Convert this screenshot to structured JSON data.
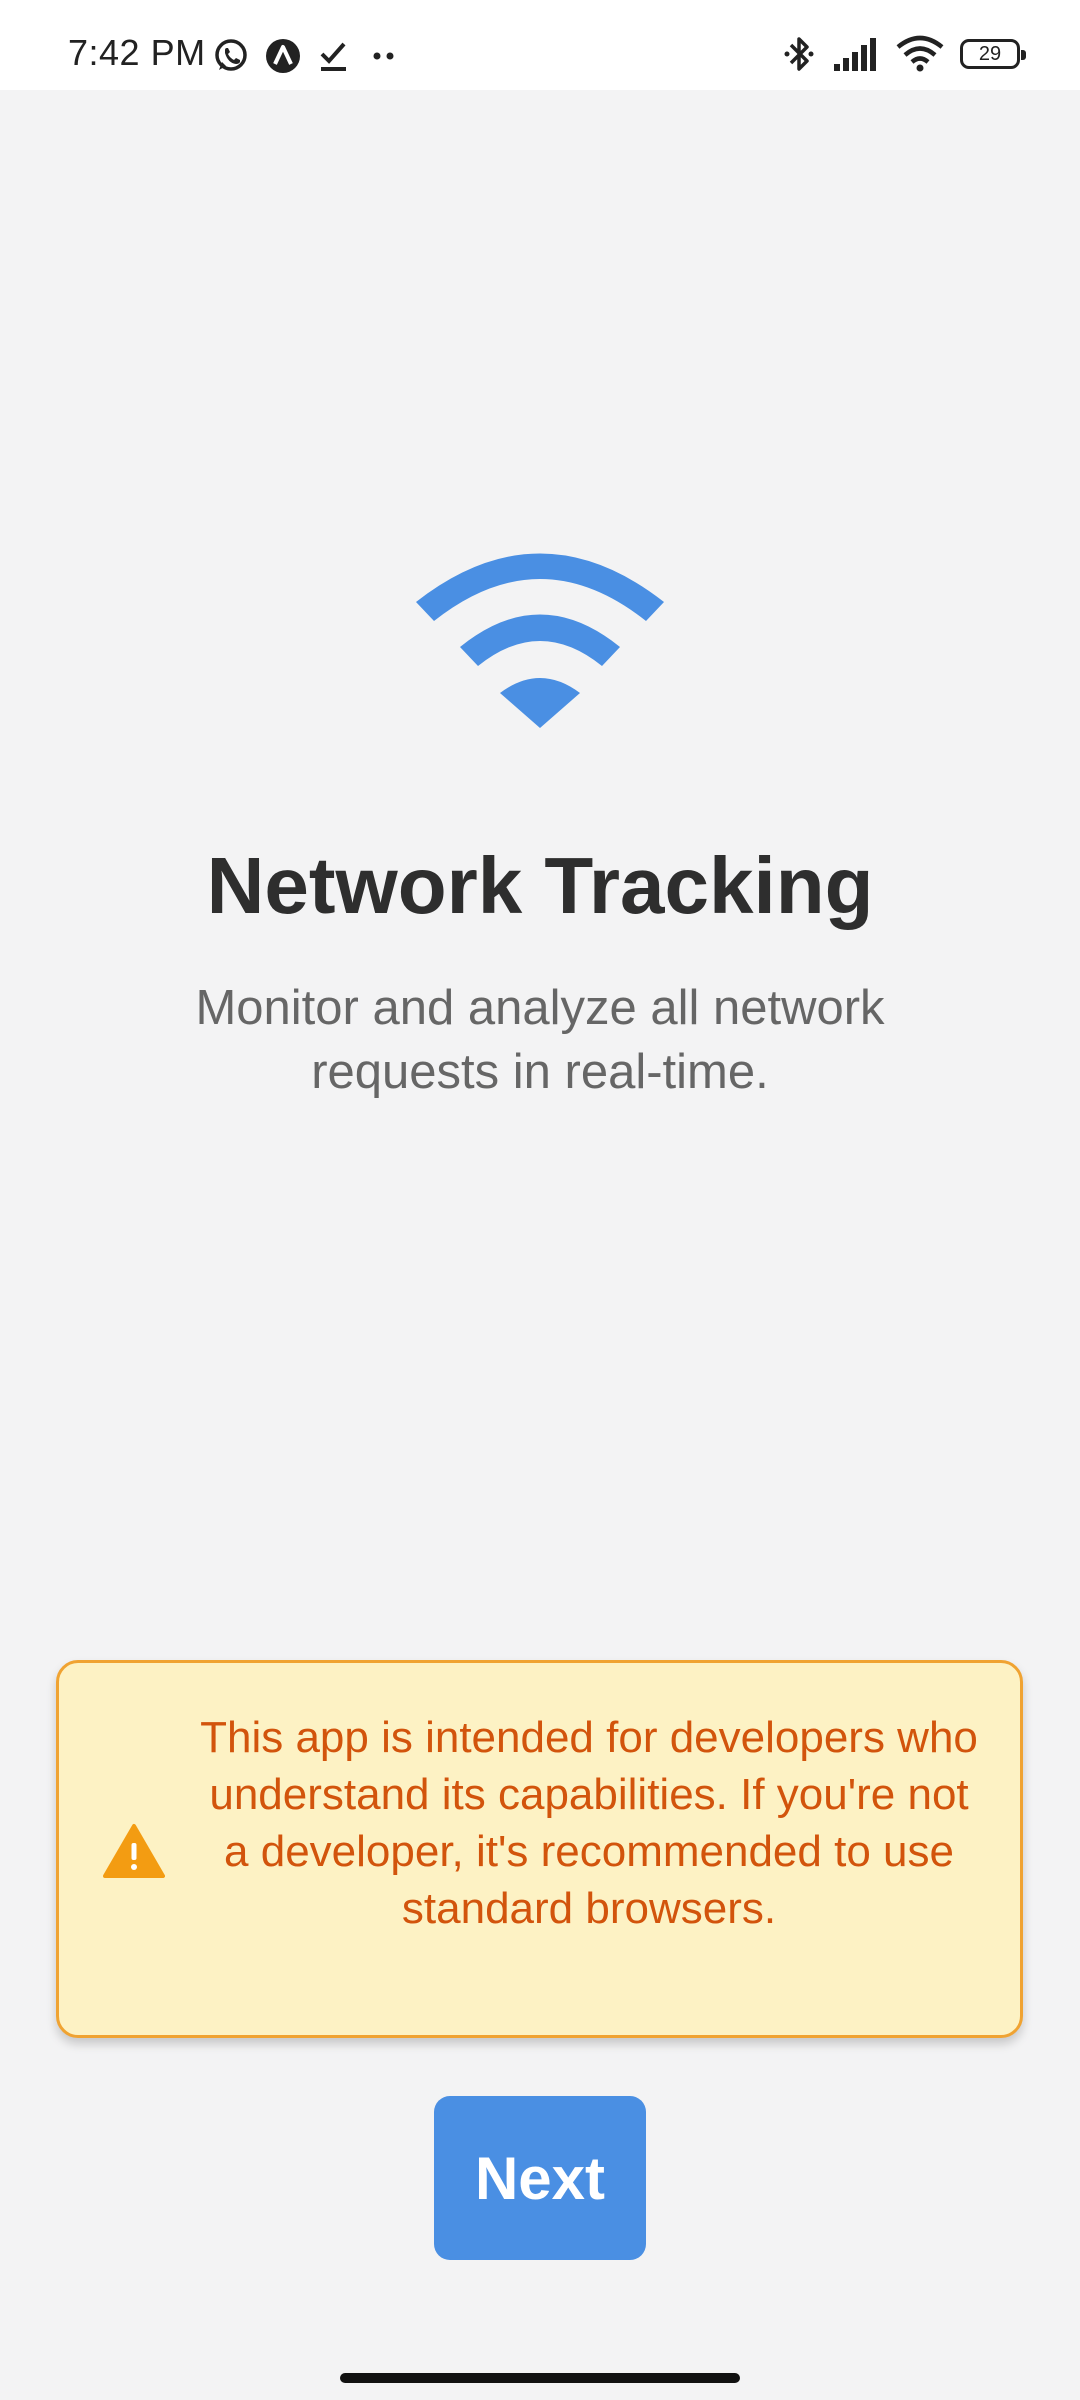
{
  "status_bar": {
    "time": "7:42 PM",
    "battery_level": "29",
    "left_icons": [
      "whatsapp-icon",
      "app-a-icon",
      "checkmark-icon",
      "more-dots-icon"
    ],
    "right_icons": [
      "bluetooth-icon",
      "signal-icon",
      "wifi-icon",
      "battery-icon"
    ]
  },
  "hero": {
    "icon": "wifi-icon",
    "icon_color": "#4a8fe3",
    "title": "Network Tracking",
    "subtitle": "Monitor and analyze all network requests in real-time."
  },
  "warning": {
    "icon": "warning-icon",
    "icon_color": "#f39c12",
    "text": "This app is intended for developers who understand its capabilities. If you're not a developer, it's recommended to use standard browsers.",
    "background": "#fdf2c4",
    "border_color": "#f0a332",
    "text_color": "#d2540c"
  },
  "actions": {
    "next_label": "Next",
    "accent": "#4a8fe3"
  }
}
